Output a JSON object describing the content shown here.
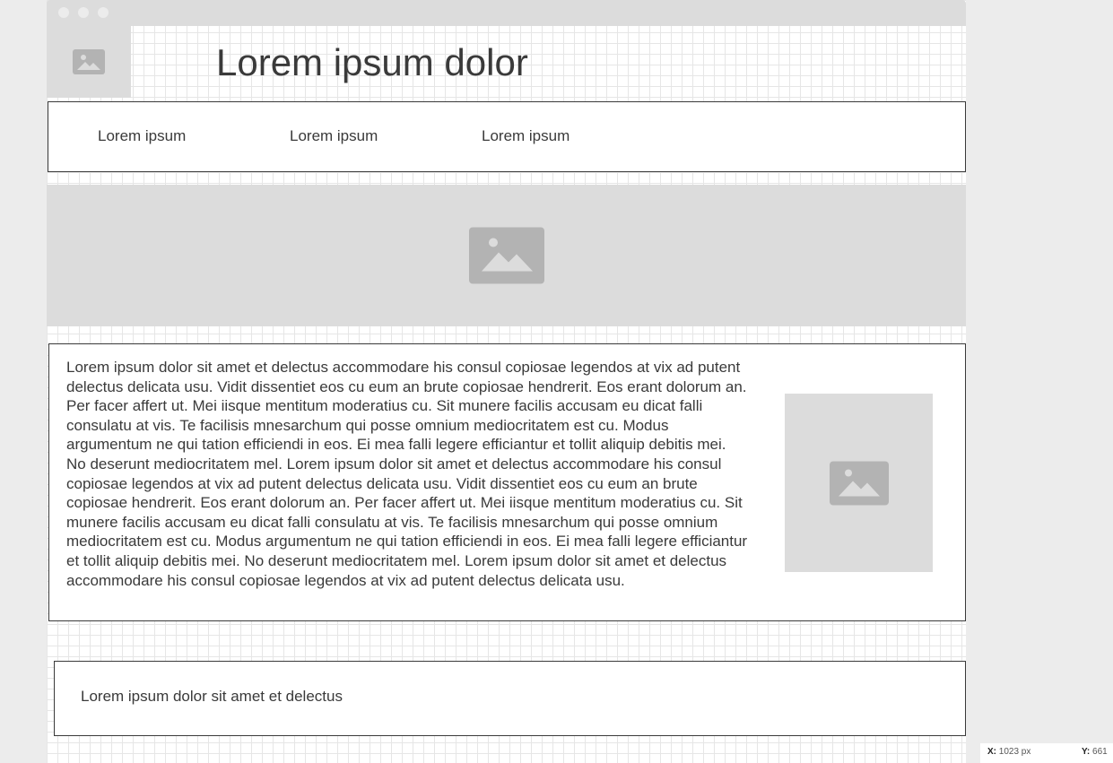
{
  "page_title": "Lorem ipsum dolor",
  "nav": {
    "items": [
      {
        "label": "Lorem ipsum"
      },
      {
        "label": "Lorem ipsum"
      },
      {
        "label": "Lorem ipsum"
      }
    ]
  },
  "content": {
    "paragraph": "Lorem ipsum dolor sit amet et delectus accommodare his consul copiosae legendos at vix ad putent delectus delicata usu. Vidit dissentiet eos cu eum an brute copiosae hendrerit. Eos erant dolorum an. Per facer affert ut. Mei iisque mentitum moderatius cu. Sit munere facilis accusam eu dicat falli consulatu at vis. Te facilisis mnesarchum qui posse omnium mediocritatem est cu. Modus argumentum ne qui tation efficiendi in eos. Ei mea falli legere efficiantur et tollit aliquip debitis mei. No deserunt mediocritatem mel. Lorem ipsum dolor sit amet et delectus accommodare his consul copiosae legendos at vix ad putent delectus delicata usu. Vidit dissentiet eos cu eum an brute copiosae hendrerit. Eos erant dolorum an. Per facer affert ut. Mei iisque mentitum moderatius cu. Sit munere facilis accusam eu dicat falli consulatu at vis. Te facilisis mnesarchum qui posse omnium mediocritatem est cu. Modus argumentum ne qui tation efficiendi in eos. Ei mea falli legere efficiantur et tollit aliquip debitis mei. No deserunt mediocritatem mel. Lorem ipsum dolor sit amet et delectus accommodare his consul copiosae legendos at vix ad putent delectus delicata usu."
  },
  "footer": {
    "text": "Lorem ipsum dolor sit amet et delectus"
  },
  "status_bar": {
    "x_label": "X:",
    "x_value": "1023 px",
    "y_label": "Y:",
    "y_value": "661"
  },
  "icons": {
    "logo_placeholder": "image-icon",
    "hero_placeholder": "image-icon",
    "side_placeholder": "image-icon"
  },
  "colors": {
    "background": "#ececec",
    "canvas": "#ffffff",
    "grid": "#e6e6e6",
    "placeholder": "#dcdcdc",
    "placeholder_icon": "#b3b3b3",
    "text": "#3a3a3a",
    "border": "#3a3a3a"
  }
}
